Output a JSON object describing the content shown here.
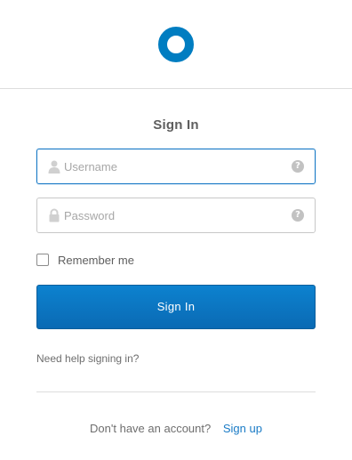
{
  "header": {
    "logo_icon": "okta-ring-logo-icon",
    "brand_color": "#007dc1"
  },
  "form": {
    "title": "Sign In",
    "username": {
      "placeholder": "Username",
      "value": "",
      "icon": "person-icon",
      "help_icon": "question-circle-icon",
      "help_glyph": "?"
    },
    "password": {
      "placeholder": "Password",
      "value": "",
      "icon": "lock-icon",
      "help_icon": "question-circle-icon",
      "help_glyph": "?"
    },
    "remember_me": {
      "label": "Remember me",
      "checked": false
    },
    "submit_label": "Sign In",
    "submit_color": "#0a6ab4",
    "help_link": "Need help signing in?"
  },
  "footer": {
    "signup_prompt": "Don't have an account?",
    "signup_link": "Sign up",
    "link_color": "#1a7bc6"
  }
}
